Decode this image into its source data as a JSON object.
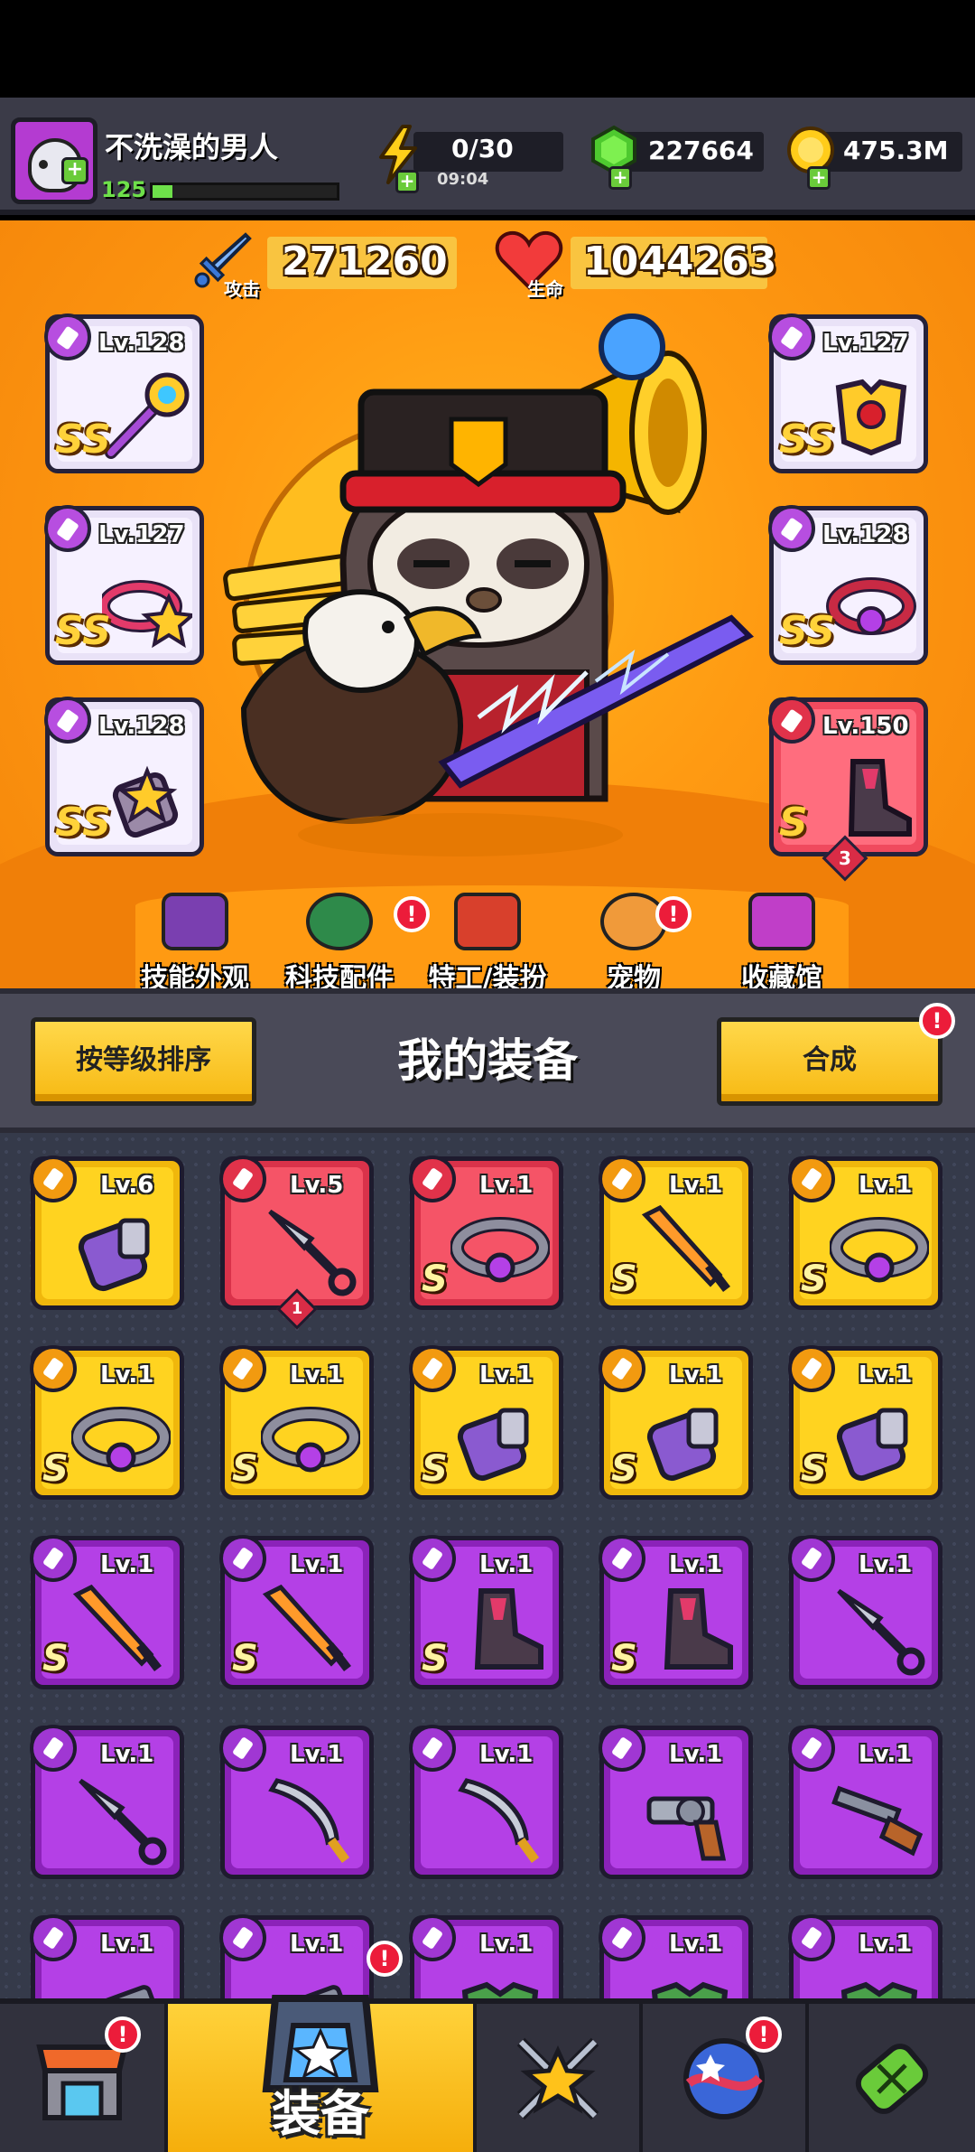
{
  "player": {
    "name": "不洗澡的男人",
    "level": "125",
    "xp_fraction": 0.11
  },
  "resources": {
    "energy": "0/30",
    "energy_timer": "09:04",
    "gems": "227664",
    "coins": "475.3M"
  },
  "stats": {
    "attack_value": "271260",
    "attack_label": "攻击",
    "hp_value": "1044263",
    "hp_label": "生命"
  },
  "equipped": {
    "left": [
      {
        "level": "Lv.128",
        "rank": "SS",
        "icon": "weapon-staff-icon"
      },
      {
        "level": "Lv.127",
        "rank": "SS",
        "icon": "necklace-icon"
      },
      {
        "level": "Lv.128",
        "rank": "SS",
        "icon": "glove-icon"
      }
    ],
    "right": [
      {
        "level": "Lv.127",
        "rank": "SS",
        "icon": "armor-icon"
      },
      {
        "level": "Lv.128",
        "rank": "SS",
        "icon": "belt-icon"
      },
      {
        "level": "Lv.150",
        "rank": "S",
        "icon": "boot-icon",
        "count": "3"
      }
    ]
  },
  "hero_nav": [
    {
      "label": "技能外观",
      "icon": "skin-icon",
      "badge": false
    },
    {
      "label": "科技配件",
      "icon": "tech-part-icon",
      "badge": true
    },
    {
      "label": "特工/装扮",
      "icon": "agent-icon",
      "badge": false
    },
    {
      "label": "宠物",
      "icon": "pet-icon",
      "badge": true
    },
    {
      "label": "收藏馆",
      "icon": "collection-icon",
      "badge": false
    }
  ],
  "equip_header": {
    "sort_label": "按等级排序",
    "title": "我的装备",
    "merge_label": "合成"
  },
  "badge_text": "!",
  "items": [
    {
      "rarity": "yellow",
      "level": "Lv.6",
      "rank": "",
      "icon": "glove-icon"
    },
    {
      "rarity": "red",
      "level": "Lv.5",
      "rank": "",
      "icon": "kunai-icon",
      "count": "1"
    },
    {
      "rarity": "red",
      "level": "Lv.1",
      "rank": "S",
      "icon": "belt-icon"
    },
    {
      "rarity": "yellow",
      "level": "Lv.1",
      "rank": "S",
      "icon": "sword-icon"
    },
    {
      "rarity": "yellow",
      "level": "Lv.1",
      "rank": "S",
      "icon": "belt-icon"
    },
    {
      "rarity": "yellow",
      "level": "Lv.1",
      "rank": "S",
      "icon": "belt-icon"
    },
    {
      "rarity": "yellow",
      "level": "Lv.1",
      "rank": "S",
      "icon": "belt-icon"
    },
    {
      "rarity": "yellow",
      "level": "Lv.1",
      "rank": "S",
      "icon": "glove-icon"
    },
    {
      "rarity": "yellow",
      "level": "Lv.1",
      "rank": "S",
      "icon": "glove-icon"
    },
    {
      "rarity": "yellow",
      "level": "Lv.1",
      "rank": "S",
      "icon": "glove-icon"
    },
    {
      "rarity": "purple",
      "level": "Lv.1",
      "rank": "S",
      "icon": "sword-icon"
    },
    {
      "rarity": "purple",
      "level": "Lv.1",
      "rank": "S",
      "icon": "sword-icon"
    },
    {
      "rarity": "purple",
      "level": "Lv.1",
      "rank": "S",
      "icon": "boot-icon"
    },
    {
      "rarity": "purple",
      "level": "Lv.1",
      "rank": "S",
      "icon": "boot-icon"
    },
    {
      "rarity": "purple",
      "level": "Lv.1",
      "rank": "",
      "icon": "kunai-icon"
    },
    {
      "rarity": "purple",
      "level": "Lv.1",
      "rank": "",
      "icon": "kunai-icon"
    },
    {
      "rarity": "purple",
      "level": "Lv.1",
      "rank": "",
      "icon": "scimitar-icon"
    },
    {
      "rarity": "purple",
      "level": "Lv.1",
      "rank": "",
      "icon": "scimitar-icon"
    },
    {
      "rarity": "purple",
      "level": "Lv.1",
      "rank": "",
      "icon": "revolver-icon"
    },
    {
      "rarity": "purple",
      "level": "Lv.1",
      "rank": "",
      "icon": "shotgun-icon"
    },
    {
      "rarity": "purple",
      "level": "Lv.1",
      "rank": "",
      "icon": "gun-icon"
    },
    {
      "rarity": "purple",
      "level": "Lv.1",
      "rank": "",
      "icon": "gun-icon"
    },
    {
      "rarity": "purple",
      "level": "Lv.1",
      "rank": "",
      "icon": "armor-icon"
    },
    {
      "rarity": "purple",
      "level": "Lv.1",
      "rank": "",
      "icon": "armor-icon"
    },
    {
      "rarity": "purple",
      "level": "Lv.1",
      "rank": "",
      "icon": "armor-icon"
    }
  ],
  "bottom_nav": [
    {
      "label": "",
      "icon": "shop-icon",
      "badge": true,
      "active": false
    },
    {
      "label": "装备",
      "icon": "equipment-icon",
      "badge": true,
      "active": true
    },
    {
      "label": "",
      "icon": "star-swords-icon",
      "badge": false,
      "active": false
    },
    {
      "label": "",
      "icon": "planet-icon",
      "badge": true,
      "active": false
    },
    {
      "label": "",
      "icon": "dna-icon",
      "badge": false,
      "active": false
    }
  ]
}
